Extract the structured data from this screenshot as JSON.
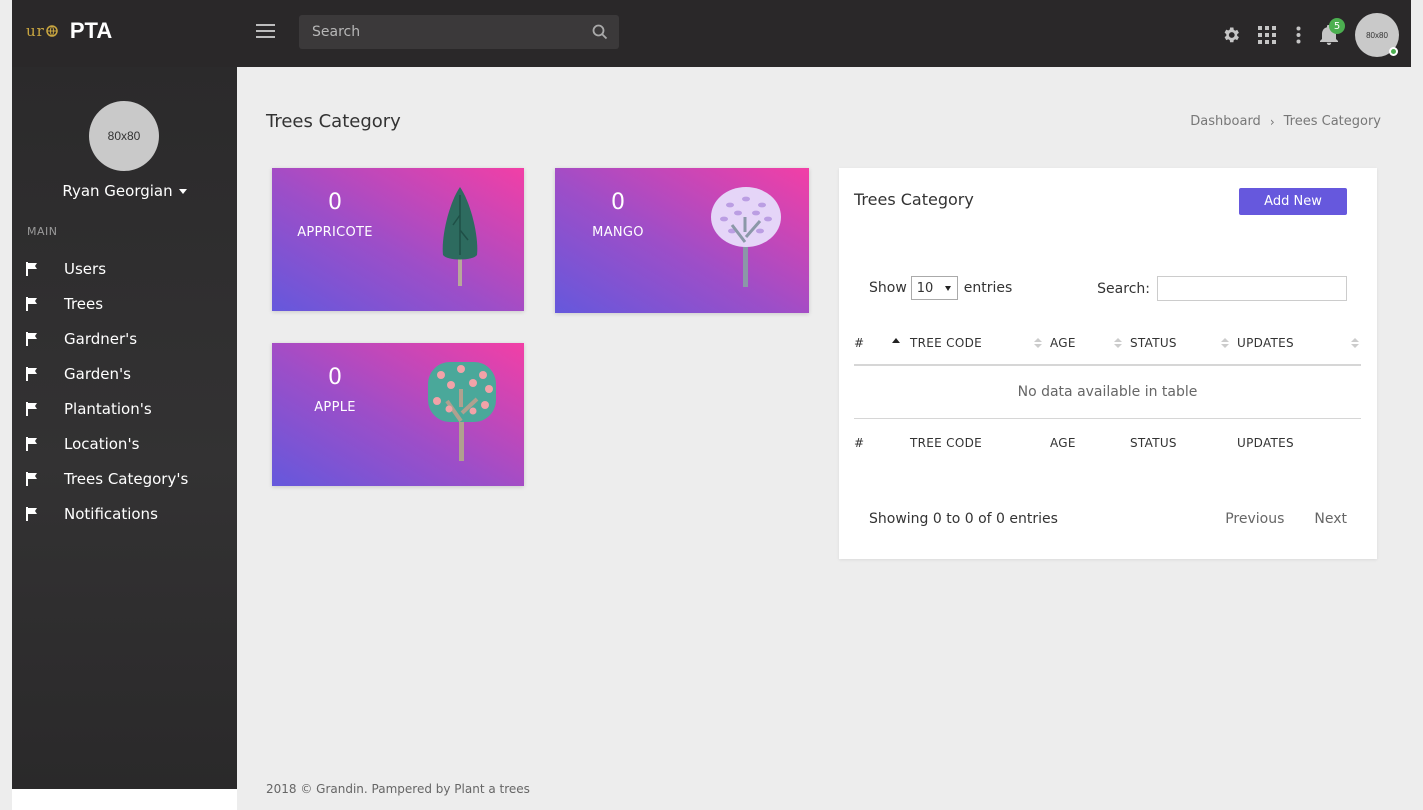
{
  "app": {
    "logo_text": "ur",
    "brand": "PTA"
  },
  "topbar": {
    "search_placeholder": "Search",
    "notification_count": "5",
    "avatar_text": "80x80",
    "icons": [
      "menu-icon",
      "search-icon",
      "gear-icon",
      "apps-grid-icon",
      "more-vertical-icon",
      "bell-icon"
    ]
  },
  "sidebar": {
    "avatar_text": "80x80",
    "user_name": "Ryan Georgian",
    "section": "MAIN",
    "items": [
      {
        "label": "Users"
      },
      {
        "label": "Trees"
      },
      {
        "label": "Gardner's"
      },
      {
        "label": "Garden's"
      },
      {
        "label": "Plantation's"
      },
      {
        "label": "Location's"
      },
      {
        "label": "Trees Category's"
      },
      {
        "label": "Notifications"
      }
    ]
  },
  "page": {
    "title": "Trees Category",
    "breadcrumb": [
      "Dashboard",
      "Trees Category"
    ]
  },
  "cards": [
    {
      "count": "0",
      "label": "APPRICOTE",
      "icon": "cypress-tree-icon"
    },
    {
      "count": "0",
      "label": "MANGO",
      "icon": "lilac-tree-icon"
    },
    {
      "count": "0",
      "label": "APPLE",
      "icon": "apple-tree-icon"
    }
  ],
  "panel": {
    "title": "Trees Category",
    "add_button": "Add New",
    "show_label": "Show",
    "entries_value": "10",
    "entries_label": "entries",
    "search_label": "Search:",
    "columns": [
      "#",
      "TREE CODE",
      "AGE",
      "STATUS",
      "UPDATES"
    ],
    "empty_message": "No data available in table",
    "info": "Showing 0 to 0 of 0 entries",
    "prev": "Previous",
    "next": "Next"
  },
  "footer": "2018 © Grandin. Pampered by Plant a trees",
  "colors": {
    "accent": "#6658dd",
    "card_from": "#6558dc",
    "card_to": "#f23fa6",
    "topbar": "#2a2829"
  }
}
